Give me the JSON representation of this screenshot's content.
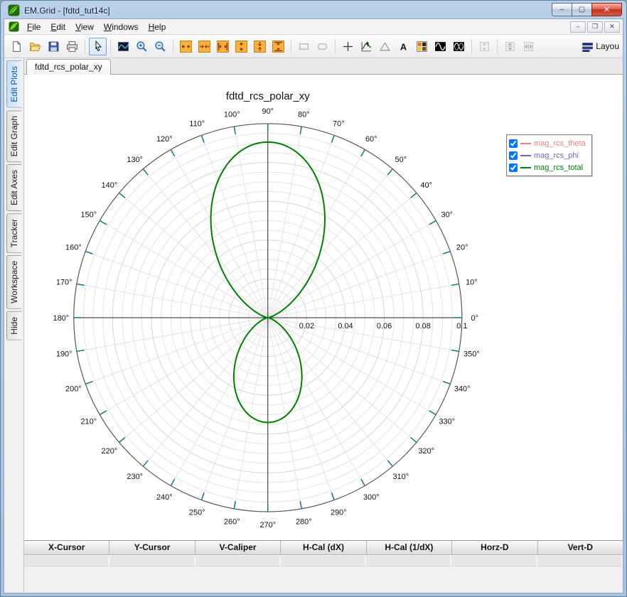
{
  "window": {
    "title": "EM.Grid - [fdtd_tut14c]",
    "controls": {
      "minimize": "–",
      "maximize": "▢",
      "close": "✕"
    }
  },
  "menu": {
    "items": [
      "File",
      "Edit",
      "View",
      "Windows",
      "Help"
    ],
    "mdi_controls": {
      "minimize": "–",
      "restore": "❐",
      "close": "✕"
    }
  },
  "toolbar": {
    "layout_label": "Layou",
    "icons": [
      "new-document",
      "open-folder",
      "save",
      "print",
      "pointer-select",
      "zoom-window",
      "zoom-in",
      "zoom-out",
      "expand-horizontal",
      "shrink-horizontal",
      "fit-horizontal",
      "expand-vertical",
      "shrink-vertical",
      "fit-vertical",
      "rectangle-tool",
      "rounded-rectangle-tool",
      "crosshair-tool",
      "curve-tracker-tool",
      "triangle-tool",
      "text-tool",
      "palette",
      "waveform-single",
      "waveform-double",
      "fit-height",
      "pan-vertical",
      "pan-horizontal",
      "layout"
    ]
  },
  "sidebar": {
    "tabs": [
      {
        "label": "Edit Plots",
        "active": true
      },
      {
        "label": "Edit Graph",
        "active": false
      },
      {
        "label": "Edit Axes",
        "active": false
      },
      {
        "label": "Tracker",
        "active": false
      },
      {
        "label": "Workspace",
        "active": false
      },
      {
        "label": "Hide",
        "active": false
      }
    ]
  },
  "doc_tab": {
    "label": "fdtd_rcs_polar_xy"
  },
  "chart_data": {
    "type": "polar",
    "title": "fdtd_rcs_polar_xy",
    "angle_step_deg": 10,
    "angle_labels": [
      "0°",
      "10°",
      "20°",
      "30°",
      "40°",
      "50°",
      "60°",
      "70°",
      "80°",
      "90°",
      "100°",
      "110°",
      "120°",
      "130°",
      "140°",
      "150°",
      "160°",
      "170°",
      "180°",
      "190°",
      "200°",
      "210°",
      "220°",
      "230°",
      "240°",
      "250°",
      "260°",
      "270°",
      "280°",
      "290°",
      "300°",
      "310°",
      "320°",
      "330°",
      "340°",
      "350°"
    ],
    "radial": {
      "max": 0.1,
      "minor_step": 0.005,
      "major_step": 0.02,
      "major_ticks": [
        0.02,
        0.04,
        0.06,
        0.08,
        0.1
      ],
      "tick_labels": [
        "0.02",
        "0.04",
        "0.06",
        "0.08",
        "0.1"
      ]
    },
    "grid": {
      "rings": true,
      "spokes_every_deg": 10,
      "tick_color": "#1a7c8c",
      "grid_color": "#e3e3e3"
    },
    "series": [
      {
        "name": "mag_rcs_theta",
        "color": "#f08080",
        "checked": true,
        "lobes": null
      },
      {
        "name": "mag_rcs_phi",
        "color": "#6a6ab8",
        "checked": true,
        "lobes": null
      },
      {
        "name": "mag_rcs_total",
        "color": "#008000",
        "checked": true,
        "lobes": {
          "up_peak": 0.0905,
          "down_peak": 0.054,
          "exponent": 3,
          "shape": "r = peak*|sin(theta)|^3, lobes at 90 and 270 deg"
        }
      }
    ],
    "legend_position": "top-right"
  },
  "status_table": {
    "columns": [
      "X-Cursor",
      "Y-Cursor",
      "V-Caliper",
      "H-Cal (dX)",
      "H-Cal (1/dX)",
      "Horz-D",
      "Vert-D"
    ],
    "row": [
      "",
      "",
      "",
      "",
      "",
      "",
      ""
    ]
  },
  "colors": {
    "titlebar_top": "#b9cfe8",
    "close_button": "#c03420",
    "active_side_tab": "#c9dff6",
    "curve_green": "#008000",
    "tick_teal": "#1a7c8c"
  }
}
